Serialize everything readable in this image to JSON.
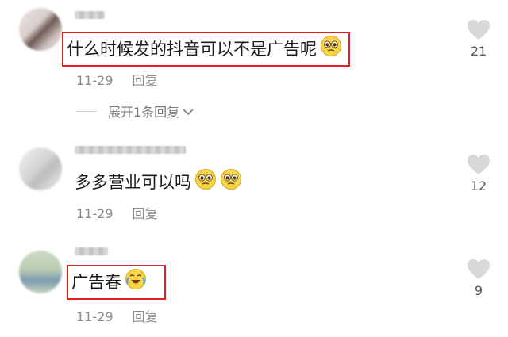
{
  "comments": [
    {
      "text": "什么时候发的抖音可以不是广告呢",
      "date": "11-29",
      "reply": "回复",
      "likes": "21",
      "emojis": [
        "pleading-face-icon"
      ]
    },
    {
      "text": "多多营业可以吗",
      "date": "11-29",
      "reply": "回复",
      "likes": "12",
      "emojis": [
        "pleading-face-icon",
        "pleading-face-icon"
      ]
    },
    {
      "text": "广告春",
      "date": "11-29",
      "reply": "回复",
      "likes": "9",
      "emojis": [
        "crying-laughing-face-icon"
      ]
    }
  ],
  "expand_replies": "展开1条回复",
  "colors": {
    "highlight_box": "#e02020",
    "meta_text": "#8a8a8a",
    "like_icon": "#d8d8d8"
  }
}
